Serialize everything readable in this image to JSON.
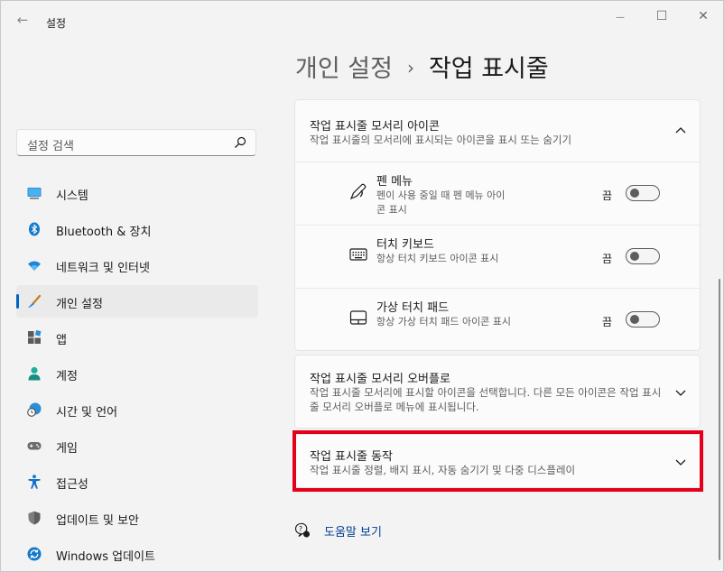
{
  "window": {
    "app_title": "설정",
    "back_glyph": "←",
    "minimize_glyph": "—",
    "maximize_glyph": "☐",
    "close_glyph": "✕"
  },
  "search": {
    "placeholder": "설정 검색"
  },
  "sidebar": {
    "items": [
      {
        "label": "시스템",
        "icon": "monitor-icon",
        "selected": false
      },
      {
        "label": "Bluetooth & 장치",
        "icon": "bluetooth-icon",
        "selected": false
      },
      {
        "label": "네트워크 및 인터넷",
        "icon": "wifi-icon",
        "selected": false
      },
      {
        "label": "개인 설정",
        "icon": "brush-icon",
        "selected": true
      },
      {
        "label": "앱",
        "icon": "apps-icon",
        "selected": false
      },
      {
        "label": "계정",
        "icon": "person-icon",
        "selected": false
      },
      {
        "label": "시간 및 언어",
        "icon": "globe-clock-icon",
        "selected": false
      },
      {
        "label": "게임",
        "icon": "gamepad-icon",
        "selected": false
      },
      {
        "label": "접근성",
        "icon": "accessibility-icon",
        "selected": false
      },
      {
        "label": "업데이트 및 보안",
        "icon": "shield-icon",
        "selected": false
      },
      {
        "label": "Windows 업데이트",
        "icon": "sync-icon",
        "selected": false
      }
    ]
  },
  "header": {
    "parent": "개인 설정",
    "separator": "›",
    "current": "작업 표시줄"
  },
  "corner_icons_card": {
    "title": "작업 표시줄 모서리 아이콘",
    "description": "작업 표시줄의 모서리에 표시되는 아이콘을 표시 또는 숨기기",
    "items": [
      {
        "title": "펜 메뉴",
        "description": "펜이 사용 중일 때 펜 메뉴 아이콘 표시",
        "state": "끔",
        "on": false,
        "icon": "pen-icon"
      },
      {
        "title": "터치 키보드",
        "description": "항상 터치 키보드 아이콘 표시",
        "state": "끔",
        "on": false,
        "icon": "keyboard-icon"
      },
      {
        "title": "가상 터치 패드",
        "description": "항상 가상 터치 패드 아이콘 표시",
        "state": "끔",
        "on": false,
        "icon": "touchpad-icon"
      }
    ]
  },
  "overflow_card": {
    "title": "작업 표시줄 모서리 오버플로",
    "description": "작업 표시줄 모서리에 표시할 아이콘을 선택합니다. 다른 모든 아이콘은 작업 표시줄 모서리 오버플로 메뉴에 표시됩니다."
  },
  "behavior_card": {
    "title": "작업 표시줄 동작",
    "description": "작업 표시줄 정렬, 배지 표시, 자동 숨기기 및 다중 디스플레이"
  },
  "help": {
    "label": "도움말 보기"
  },
  "colors": {
    "accent": "#0067c0",
    "highlight": "#e4001b",
    "link": "#003e92"
  }
}
